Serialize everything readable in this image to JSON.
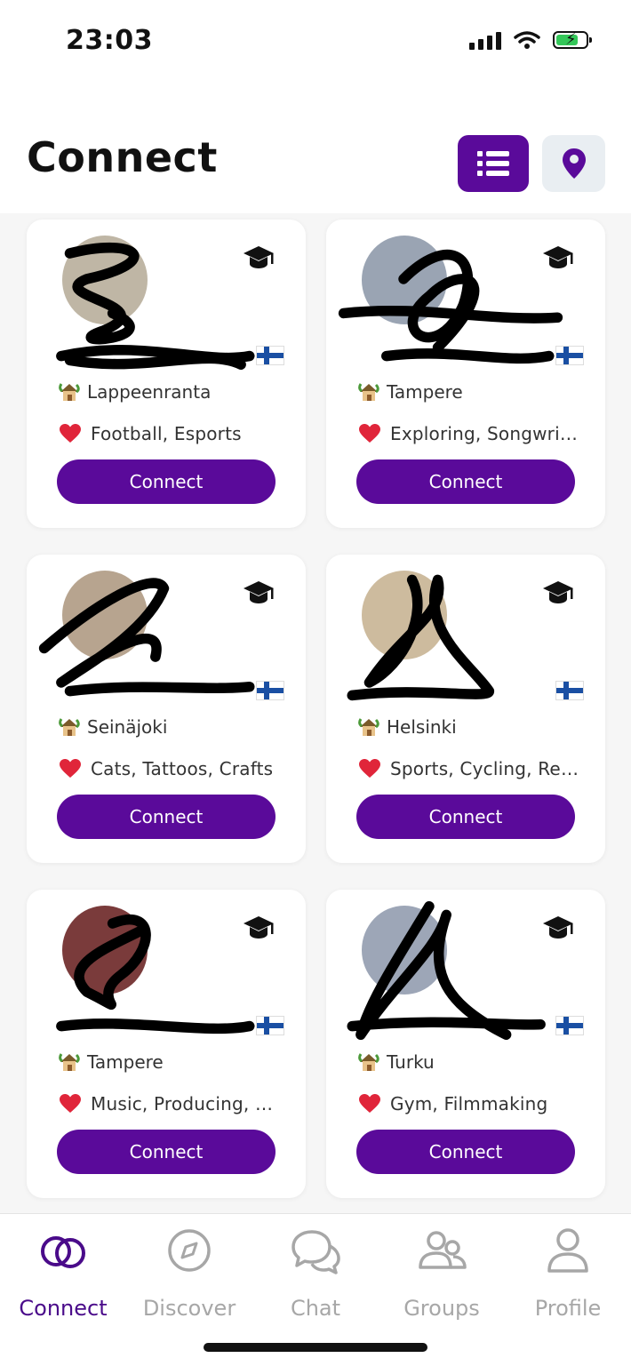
{
  "status_bar": {
    "time": "23:03"
  },
  "header": {
    "title": "Connect"
  },
  "cards": [
    {
      "city": "Lappeenranta",
      "interests": "Football,  Esports",
      "connect_label": "Connect"
    },
    {
      "city": "Tampere",
      "interests": "Exploring,  Songwriti…",
      "connect_label": "Connect"
    },
    {
      "city": "Seinäjoki",
      "interests": "Cats,  Tattoos,  Crafts",
      "connect_label": "Connect"
    },
    {
      "city": "Helsinki",
      "interests": "Sports,  Cycling,  Rea…",
      "connect_label": "Connect"
    },
    {
      "city": "Tampere",
      "interests": "Music,  Producing,  V…",
      "connect_label": "Connect"
    },
    {
      "city": "Turku",
      "interests": "Gym,  Filmmaking",
      "connect_label": "Connect"
    }
  ],
  "tab_bar": {
    "tabs": [
      {
        "label": "Connect",
        "icon": "connect-rings-icon",
        "active": true
      },
      {
        "label": "Discover",
        "icon": "compass-icon",
        "active": false
      },
      {
        "label": "Chat",
        "icon": "chat-bubbles-icon",
        "active": false
      },
      {
        "label": "Groups",
        "icon": "group-icon",
        "active": false
      },
      {
        "label": "Profile",
        "icon": "person-icon",
        "active": false
      }
    ]
  },
  "colors": {
    "accent": "#5a0a9a",
    "tab_active": "#4a0b8a",
    "tab_inactive": "#a7a7a7"
  }
}
